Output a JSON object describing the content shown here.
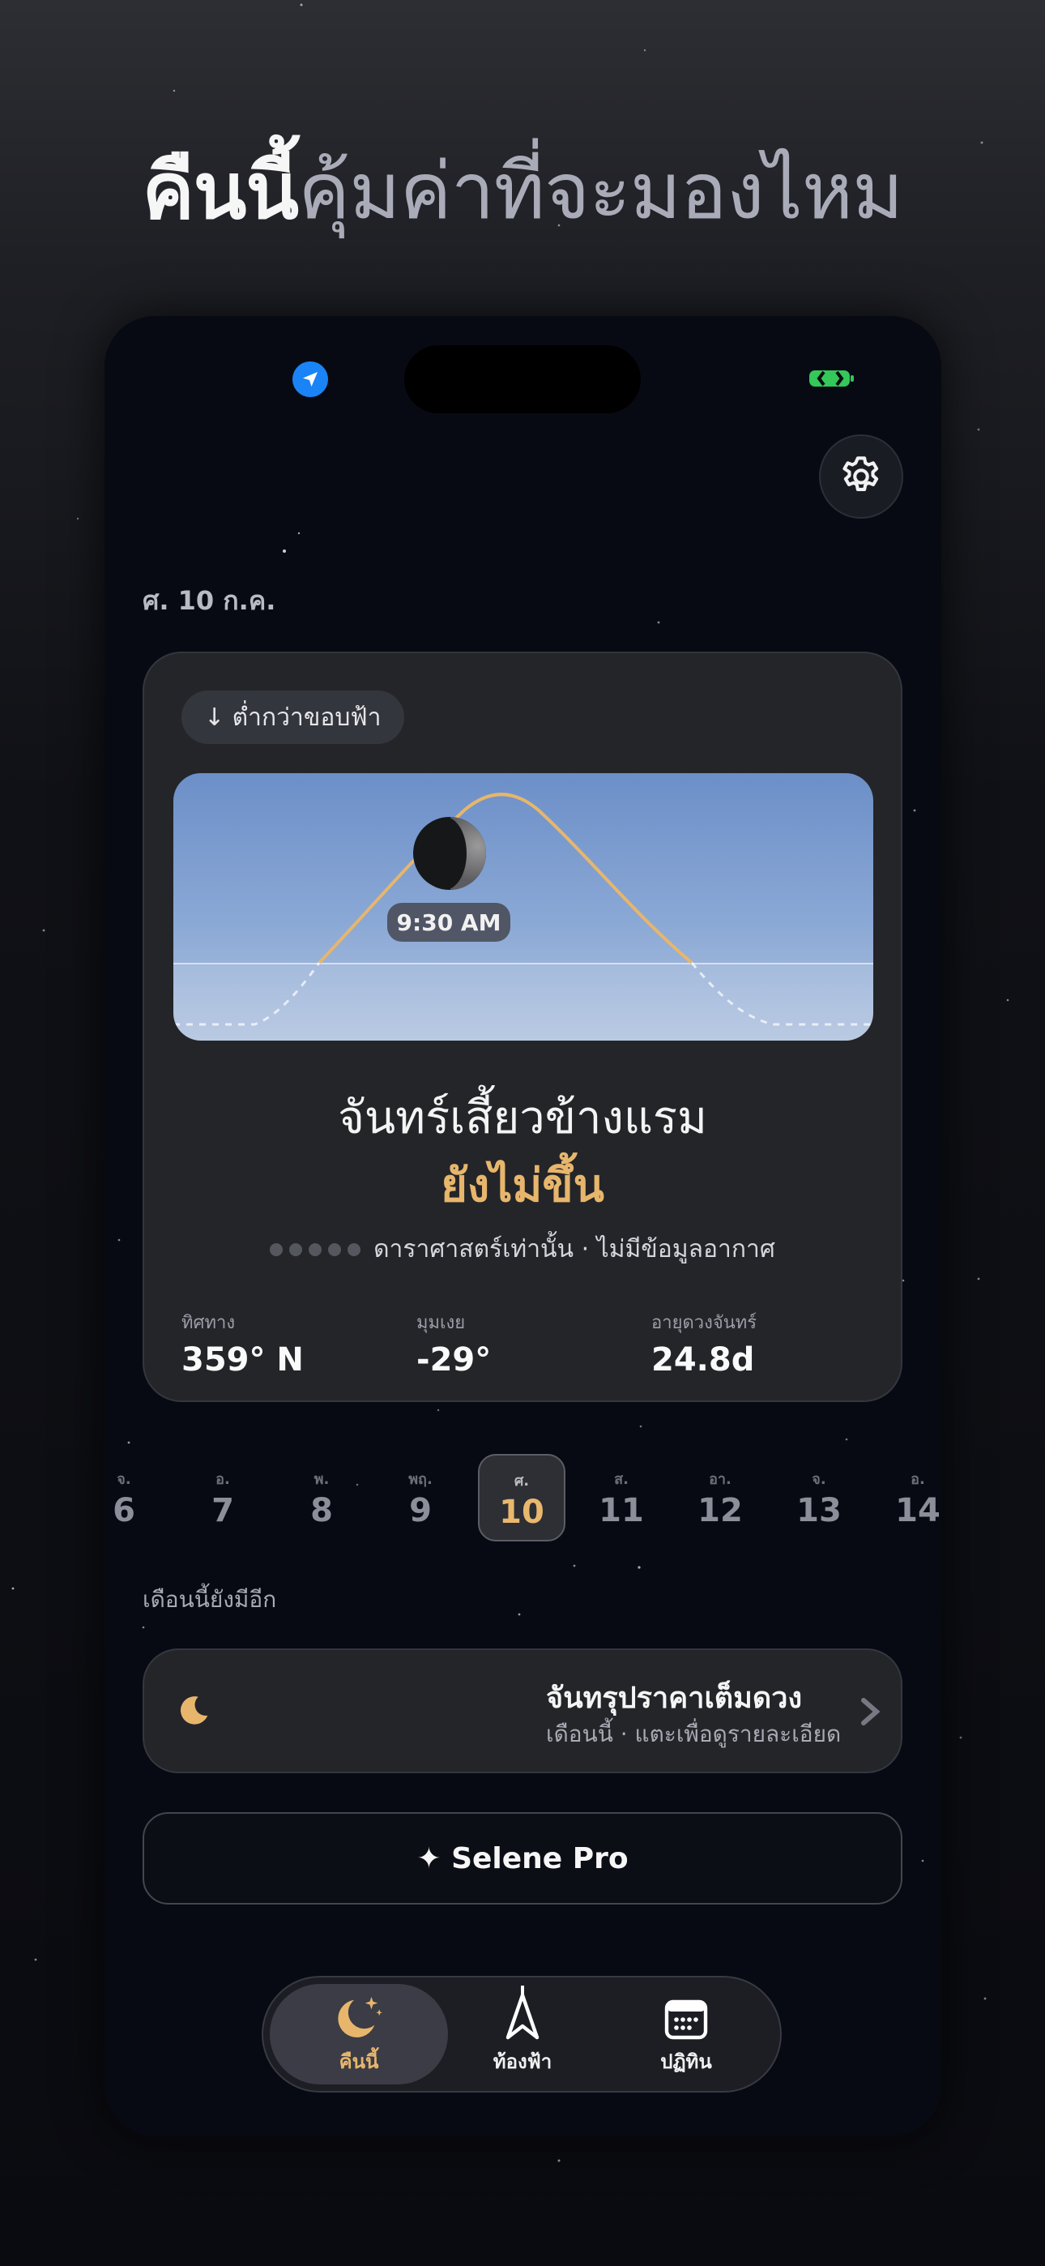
{
  "headline": {
    "bright": "คืนนี้",
    "dim": "คุ้มค่าที่จะมองไหม"
  },
  "status_bar": {
    "location_icon": "location-arrow-icon",
    "battery_icon": "battery-icon"
  },
  "settings": {
    "icon": "gear-icon"
  },
  "date_label": "ศ. 10 ก.ค.",
  "moon_card": {
    "horizon_pill": "↓ ต่ำกว่าขอบฟ้า",
    "time_chip": "9:30 AM",
    "phase_name": "จันทร์เสี้ยวข้างแรม",
    "status": "ยังไม่ขึ้น",
    "quality_dots_filled": 0,
    "quality_dots_total": 5,
    "quality_text": "ดาราศาสตร์เท่านั้น · ไม่มีข้อมูลอากาศ",
    "stats": [
      {
        "label": "ทิศทาง",
        "value": "359° N"
      },
      {
        "label": "มุมเงย",
        "value": "-29°"
      },
      {
        "label": "อายุดวงจันทร์",
        "value": "24.8d"
      }
    ]
  },
  "day_strip": [
    {
      "dow": "จ.",
      "day": "6",
      "selected": false
    },
    {
      "dow": "อ.",
      "day": "7",
      "selected": false
    },
    {
      "dow": "พ.",
      "day": "8",
      "selected": false
    },
    {
      "dow": "พฤ.",
      "day": "9",
      "selected": false
    },
    {
      "dow": "ศ.",
      "day": "10",
      "selected": true
    },
    {
      "dow": "ส.",
      "day": "11",
      "selected": false
    },
    {
      "dow": "อา.",
      "day": "12",
      "selected": false
    },
    {
      "dow": "จ.",
      "day": "13",
      "selected": false
    },
    {
      "dow": "อ.",
      "day": "14",
      "selected": false
    }
  ],
  "more_label": "เดือนนี้ยังมีอีก",
  "event": {
    "icon": "crescent-moon-icon",
    "title": "จันทรุปราคาเต็มดวง",
    "subtitle": "เดือนนี้ · แตะเพื่อดูรายละเอียด"
  },
  "pro_button": "✦ Selene Pro",
  "tabs": [
    {
      "label": "คืนนี้",
      "icon": "moon-stars-icon",
      "active": true
    },
    {
      "label": "ท้องฟ้า",
      "icon": "compass-needle-icon",
      "active": false
    },
    {
      "label": "ปฏิทิน",
      "icon": "calendar-icon",
      "active": false
    }
  ],
  "colors": {
    "accent": "#e7b66c",
    "background": "#080a13",
    "card": "#242529",
    "location_blue": "#1a84f6",
    "battery_green": "#34c759"
  }
}
